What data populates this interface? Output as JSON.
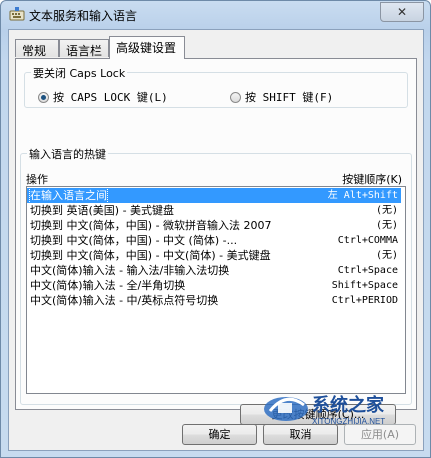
{
  "window": {
    "title": "文本服务和输入语言",
    "close_glyph": "✕"
  },
  "tabs": [
    {
      "label": "常规",
      "active": false
    },
    {
      "label": "语言栏",
      "active": false
    },
    {
      "label": "高级键设置",
      "active": true
    }
  ],
  "caps_lock": {
    "group_label": "要关闭 Caps Lock",
    "options": [
      {
        "label": "按 CAPS LOCK 键(L)",
        "selected": true
      },
      {
        "label": "按 SHIFT 键(F)",
        "selected": false
      }
    ]
  },
  "hotkeys": {
    "group_label": "输入语言的热键",
    "col_action": "操作",
    "col_keys": "按键顺序(K)",
    "rows": [
      {
        "action": "在输入语言之间",
        "keys": "左 Alt+Shift",
        "selected": true
      },
      {
        "action": "切换到 英语(美国) - 美式键盘",
        "keys": "(无)",
        "selected": false
      },
      {
        "action": "切换到 中文(简体，中国) - 微软拼音输入法 2007",
        "keys": "(无)",
        "selected": false
      },
      {
        "action": "切换到 中文(简体，中国) - 中文 (简体) -...",
        "keys": "Ctrl+COMMA",
        "selected": false
      },
      {
        "action": "切换到 中文(简体，中国) - 中文(简体) - 美式键盘",
        "keys": "(无)",
        "selected": false
      },
      {
        "action": "中文(简体)输入法 - 输入法/非输入法切换",
        "keys": "Ctrl+Space",
        "selected": false
      },
      {
        "action": "中文(简体)输入法 - 全/半角切换",
        "keys": "Shift+Space",
        "selected": false
      },
      {
        "action": "中文(简体)输入法 - 中/英标点符号切换",
        "keys": "Ctrl+PERIOD",
        "selected": false
      }
    ],
    "change_button": "更改按键顺序(C)..."
  },
  "buttons": {
    "ok": "确定",
    "cancel": "取消",
    "apply": "应用(A)"
  },
  "watermark": {
    "text": "系统之家",
    "url": "XITONGZHIJIA.NET"
  },
  "colors": {
    "selection": "#3399ff",
    "title_gradient_top": "#c9dcf0"
  }
}
